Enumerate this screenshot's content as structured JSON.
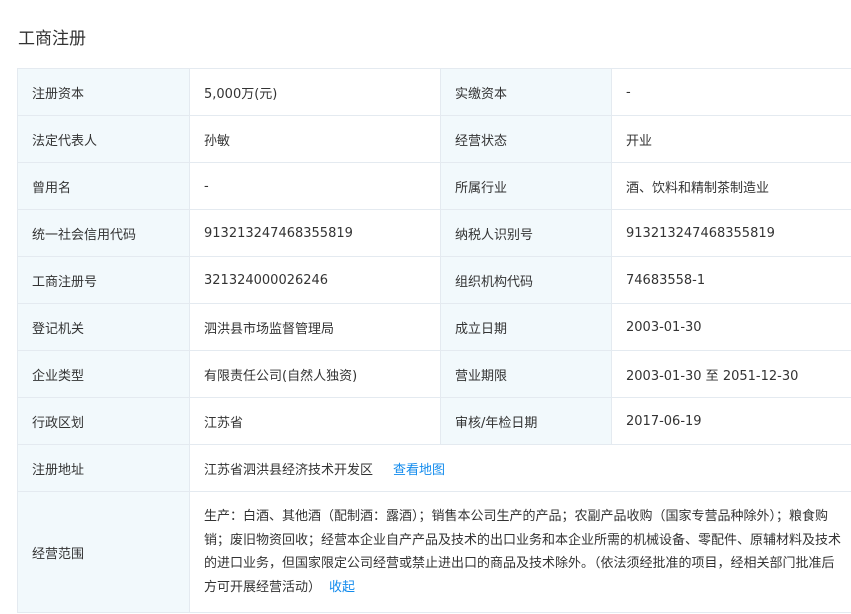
{
  "section": {
    "title": "工商注册"
  },
  "rows": [
    {
      "l1": "注册资本",
      "v1": "5,000万(元)",
      "l2": "实缴资本",
      "v2": "-"
    },
    {
      "l1": "法定代表人",
      "v1": "孙敏",
      "l2": "经营状态",
      "v2": "开业"
    },
    {
      "l1": "曾用名",
      "v1": "-",
      "l2": "所属行业",
      "v2": "酒、饮料和精制茶制造业"
    },
    {
      "l1": "统一社会信用代码",
      "v1": "913213247468355819",
      "l2": "纳税人识别号",
      "v2": "913213247468355819"
    },
    {
      "l1": "工商注册号",
      "v1": "321324000026246",
      "l2": "组织机构代码",
      "v2": "74683558-1"
    },
    {
      "l1": "登记机关",
      "v1": "泗洪县市场监督管理局",
      "l2": "成立日期",
      "v2": "2003-01-30"
    },
    {
      "l1": "企业类型",
      "v1": "有限责任公司(自然人独资)",
      "l2": "营业期限",
      "v2": "2003-01-30 至 2051-12-30"
    },
    {
      "l1": "行政区划",
      "v1": "江苏省",
      "l2": "审核/年检日期",
      "v2": "2017-06-19"
    }
  ],
  "address": {
    "label": "注册地址",
    "value": "江苏省泗洪县经济技术开发区",
    "map_link": "查看地图"
  },
  "scope": {
    "label": "经营范围",
    "text": "生产：白酒、其他酒（配制酒：露酒）；销售本公司生产的产品；农副产品收购（国家专营品种除外）；粮食购销；废旧物资回收；经营本企业自产产品及技术的出口业务和本企业所需的机械设备、零配件、原辅材料及技术的进口业务，但国家限定公司经营或禁止进出口的商品及技术除外。（依法须经批准的项目，经相关部门批准后方可开展经营活动）",
    "collapse_link": "收起"
  }
}
